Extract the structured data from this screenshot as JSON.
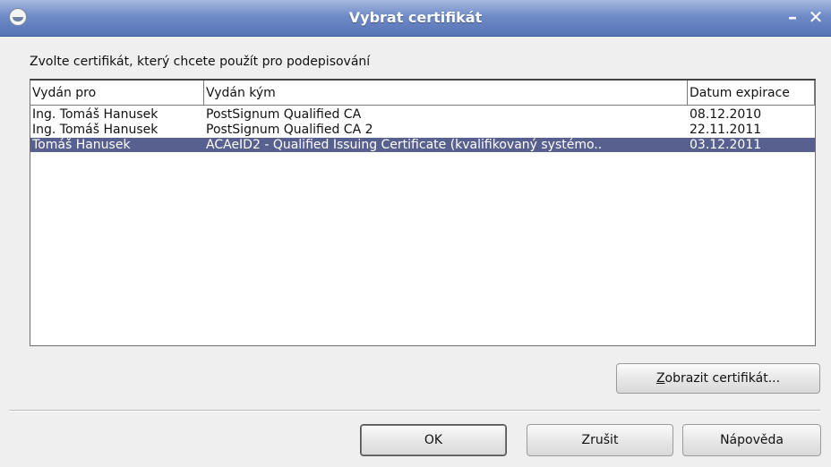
{
  "window": {
    "title": "Vybrat certifikát",
    "minimize_glyph": "–",
    "close_glyph": "✕"
  },
  "instruction": "Zvolte certifikát, který chcete použít pro podepisování",
  "table": {
    "columns": [
      "Vydán pro",
      "Vydán kým",
      "Datum expirace"
    ],
    "rows": [
      {
        "issued_to": "Ing. Tomáš Hanusek",
        "issued_by": "PostSignum Qualified CA",
        "expiry": "08.12.2010",
        "selected": false
      },
      {
        "issued_to": "Ing. Tomáš Hanusek",
        "issued_by": "PostSignum Qualified CA 2",
        "expiry": "22.11.2011",
        "selected": false
      },
      {
        "issued_to": "Tomáš Hanusek",
        "issued_by": "ACAeID2 - Qualified Issuing Certificate (kvalifikovaný systémo..",
        "expiry": "03.12.2011",
        "selected": true
      }
    ]
  },
  "buttons": {
    "view_certificate": {
      "mnemonic": "Z",
      "rest": "obrazit certifikát..."
    },
    "ok": "OK",
    "cancel": "Zrušit",
    "help": "Nápověda"
  },
  "colors": {
    "titlebar": "#5673b6",
    "selection": "#57608f"
  }
}
